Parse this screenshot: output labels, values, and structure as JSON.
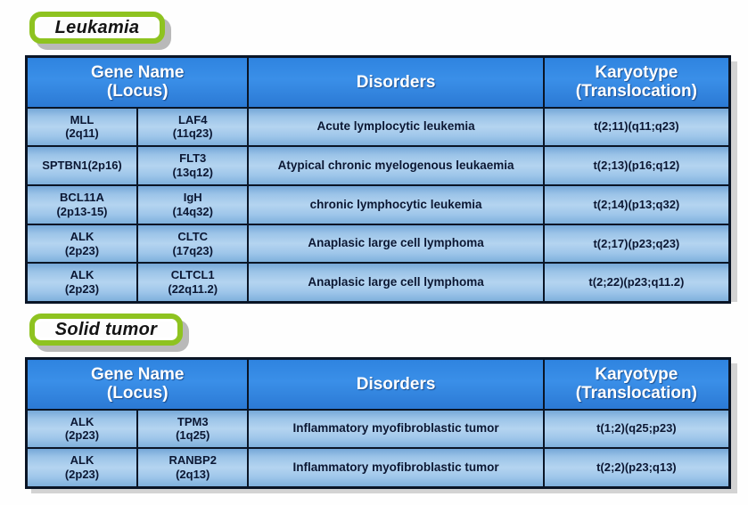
{
  "sections": [
    {
      "badge_label": "Leukamia",
      "badge_name": "leukamia",
      "table": {
        "headers": {
          "gene_name": "Gene Name",
          "gene_locus": "(Locus)",
          "disorders": "Disorders",
          "karyotype": "Karyotype",
          "karyotype_sub": "(Translocation)"
        },
        "rows": [
          {
            "gene_a": "MLL",
            "gene_a_locus": "(2q11)",
            "gene_b": "LAF4",
            "gene_b_locus": "(11q23)",
            "disorder": "Acute lymplocytic leukemia",
            "karyotype": "t(2;11)(q11;q23)"
          },
          {
            "gene_a": "SPTBN1(2p16)",
            "gene_a_locus": "",
            "gene_b": "FLT3",
            "gene_b_locus": "(13q12)",
            "disorder": "Atypical chronic myelogenous leukaemia",
            "karyotype": "t(2;13)(p16;q12)"
          },
          {
            "gene_a": "BCL11A",
            "gene_a_locus": "(2p13-15)",
            "gene_b": "IgH",
            "gene_b_locus": "(14q32)",
            "disorder": "chronic lymphocytic leukemia",
            "karyotype": "t(2;14)(p13;q32)"
          },
          {
            "gene_a": "ALK",
            "gene_a_locus": "(2p23)",
            "gene_b": "CLTC",
            "gene_b_locus": "(17q23)",
            "disorder": "Anaplasic large cell lymphoma",
            "karyotype": "t(2;17)(p23;q23)"
          },
          {
            "gene_a": "ALK",
            "gene_a_locus": "(2p23)",
            "gene_b": "CLTCL1",
            "gene_b_locus": "(22q11.2)",
            "disorder": "Anaplasic large cell lymphoma",
            "karyotype": "t(2;22)(p23;q11.2)"
          }
        ]
      }
    },
    {
      "badge_label": "Solid tumor",
      "badge_name": "solid-tumor",
      "table": {
        "headers": {
          "gene_name": "Gene Name",
          "gene_locus": "(Locus)",
          "disorders": "Disorders",
          "karyotype": "Karyotype",
          "karyotype_sub": "(Translocation)"
        },
        "rows": [
          {
            "gene_a": "ALK",
            "gene_a_locus": "(2p23)",
            "gene_b": "TPM3",
            "gene_b_locus": "(1q25)",
            "disorder": "Inflammatory myofibroblastic tumor",
            "karyotype": "t(1;2)(q25;p23)"
          },
          {
            "gene_a": "ALK",
            "gene_a_locus": "(2p23)",
            "gene_b": "RANBP2",
            "gene_b_locus": "(2q13)",
            "disorder": "Inflammatory myofibroblastic tumor",
            "karyotype": "t(2;2)(p23;q13)"
          }
        ]
      }
    }
  ],
  "colors": {
    "badge_border": "#8ec320",
    "header_blue": "#3a8fe8",
    "cell_blue": "#b4d4f0",
    "table_border": "#0a1526",
    "text_dark": "#0b1733"
  }
}
